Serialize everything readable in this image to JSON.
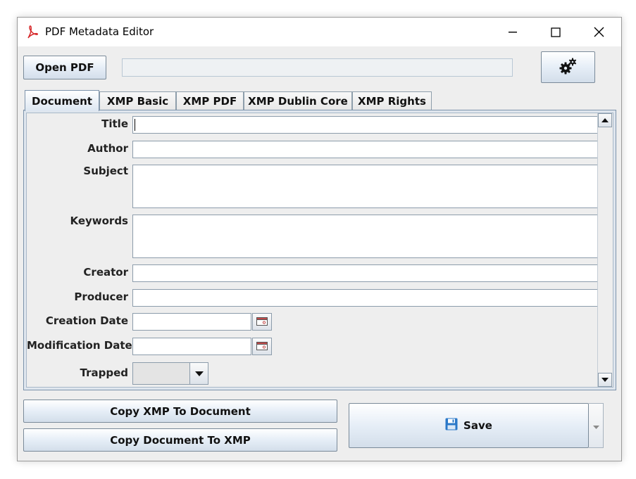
{
  "window": {
    "title": "PDF Metadata Editor",
    "app_icon": "pdf-icon"
  },
  "toolbar": {
    "open_label": "Open PDF",
    "file_path": "",
    "settings_icon": "gears-icon"
  },
  "tabs": [
    {
      "label": "Document",
      "active": true
    },
    {
      "label": "XMP Basic",
      "active": false
    },
    {
      "label": "XMP PDF",
      "active": false
    },
    {
      "label": "XMP Dublin Core",
      "active": false
    },
    {
      "label": "XMP Rights",
      "active": false
    }
  ],
  "form": {
    "title": {
      "label": "Title",
      "value": ""
    },
    "author": {
      "label": "Author",
      "value": ""
    },
    "subject": {
      "label": "Subject",
      "value": ""
    },
    "keywords": {
      "label": "Keywords",
      "value": ""
    },
    "creator": {
      "label": "Creator",
      "value": ""
    },
    "producer": {
      "label": "Producer",
      "value": ""
    },
    "creation_date": {
      "label": "Creation Date",
      "value": ""
    },
    "modification_date": {
      "label": "Modification Date",
      "value": ""
    },
    "trapped": {
      "label": "Trapped",
      "value": ""
    }
  },
  "actions": {
    "copy_xmp_to_doc": "Copy XMP To Document",
    "copy_doc_to_xmp": "Copy Document To XMP",
    "save": "Save",
    "save_icon": "floppy-disk-icon"
  },
  "colors": {
    "accent": "#7d93ab",
    "pdf_red": "#d6292b",
    "save_icon_blue": "#2a78c8"
  }
}
